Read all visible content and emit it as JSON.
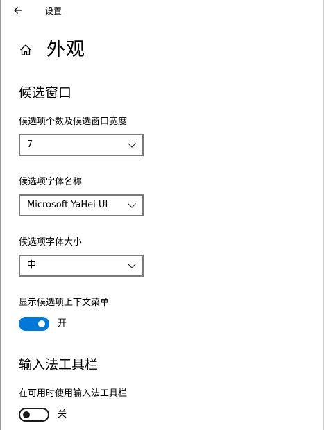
{
  "window": {
    "title": "设置"
  },
  "page": {
    "title": "外观"
  },
  "candidate_window": {
    "section_title": "候选窗口",
    "count_label": "候选项个数及候选窗口宽度",
    "count_value": "7",
    "font_name_label": "候选项字体名称",
    "font_name_value": "Microsoft YaHei UI",
    "font_size_label": "候选项字体大小",
    "font_size_value": "中",
    "context_menu_label": "显示候选项上下文菜单",
    "context_menu_state": "开",
    "context_menu_on": true
  },
  "ime_toolbar": {
    "section_title": "输入法工具栏",
    "use_toolbar_label": "在可用时使用输入法工具栏",
    "use_toolbar_state": "关",
    "use_toolbar_on": false
  },
  "colors": {
    "accent": "#0078d7",
    "text": "#000000",
    "combo_border": "#7a7a7a"
  },
  "icons": {
    "back": "back-arrow-icon",
    "home": "home-icon",
    "dropdown": "chevron-down-icon"
  }
}
